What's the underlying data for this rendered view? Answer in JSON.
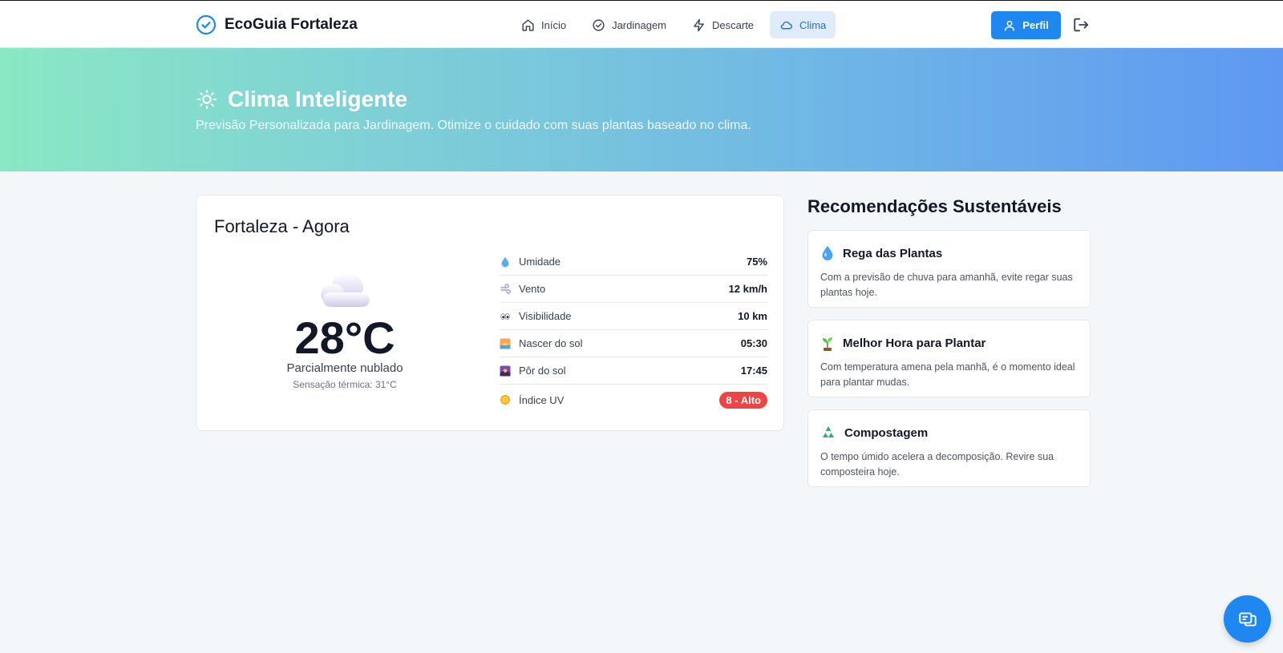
{
  "app": {
    "brand": "EcoGuia Fortaleza",
    "brand_icon": "check-circle-icon"
  },
  "nav": {
    "items": [
      {
        "label": "Início",
        "icon": "home-icon"
      },
      {
        "label": "Jardinagem",
        "icon": "check-circle-icon"
      },
      {
        "label": "Descarte",
        "icon": "lightning-icon"
      },
      {
        "label": "Clima",
        "icon": "cloud-icon",
        "active": true
      }
    ],
    "profile_label": "Perfil",
    "logout_icon": "logout-icon"
  },
  "hero": {
    "title": "Clima Inteligente",
    "subtitle": "Previsão Personalizada para Jardinagem. Otimize o cuidado com suas plantas baseado no clima."
  },
  "weather": {
    "title": "Fortaleza - Agora",
    "temperature": "28°C",
    "condition": "Parcialmente nublado",
    "feels_like": "Sensação térmica: 31°C",
    "stats": [
      {
        "label": "Umidade",
        "value": "75%",
        "icon": "droplet-icon"
      },
      {
        "label": "Vento",
        "value": "12 km/h",
        "icon": "wind-icon"
      },
      {
        "label": "Visibilidade",
        "value": "10 km",
        "icon": "eyes-icon"
      },
      {
        "label": "Nascer do sol",
        "value": "05:30",
        "icon": "sunrise-icon"
      },
      {
        "label": "Pôr do sol",
        "value": "17:45",
        "icon": "sunset-icon"
      },
      {
        "label": "Índice UV",
        "value": "8 - Alto",
        "icon": "sun-icon"
      }
    ]
  },
  "recommendations": {
    "title": "Recomendações Sustentáveis",
    "items": [
      {
        "title": "Rega das Plantas",
        "text": "Com a previsão de chuva para amanhã, evite regar suas plantas hoje.",
        "icon": "droplet-icon"
      },
      {
        "title": "Melhor Hora para Plantar",
        "text": "Com temperatura amena pela manhã, é o momento ideal para plantar mudas.",
        "icon": "seedling-icon"
      },
      {
        "title": "Compostagem",
        "text": "O tempo úmido acelera a decomposição. Revire sua composteira hoje.",
        "icon": "recycle-icon"
      }
    ]
  },
  "colors": {
    "primary": "#1e88f0",
    "uv_high": "#ef4444",
    "hero_start": "#8ae8c4",
    "hero_end": "#5e98f2"
  },
  "fab_icon": "chat-icon"
}
